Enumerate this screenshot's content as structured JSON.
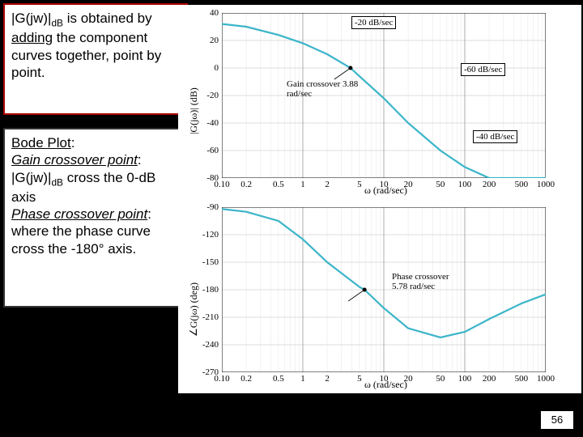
{
  "textbox1": {
    "full": "|G(jw)|dB is obtained by adding the component curves together, point by point.",
    "p1_a": "|G(jw)|",
    "p1_sub": "dB",
    "p1_b": " is obtained by ",
    "p1_add": "adding",
    "p1_c": " the component curves together, point by point."
  },
  "textbox2": {
    "heading": "Bode Plot",
    "gc1": "Gain crossover point",
    "gc2a": ": |G(jw)|",
    "gc2sub": "dB",
    "gc2b": " cross the 0-dB axis",
    "pc1": "Phase crossover point",
    "pc2": ": where the phase curve cross the -180° axis."
  },
  "figure": {
    "top": {
      "ylabel": "|G(jω)| (dB)",
      "xlabel": "ω (rad/sec)",
      "yticks": [
        "40",
        "20",
        "0",
        "-20",
        "-40",
        "-60",
        "-80"
      ],
      "xticks": [
        "0.10",
        "0.2",
        "0.5",
        "1",
        "2",
        "5",
        "10",
        "20",
        "50",
        "100",
        "200",
        "500",
        "1000"
      ],
      "annotations": {
        "a20": "-20 dB/sec",
        "a60": "-60 dB/sec",
        "a40": "-40 dB/sec",
        "gc": "Gain crossover 3.88 rad/sec"
      }
    },
    "bot": {
      "ylabel": "∠G(jω) (deg)",
      "xlabel": "ω (rad/sec)",
      "yticks": [
        "-90",
        "-120",
        "-150",
        "-180",
        "-210",
        "-240",
        "-270"
      ],
      "xticks": [
        "0.10",
        "0.2",
        "0.5",
        "1",
        "2",
        "5",
        "10",
        "20",
        "50",
        "100",
        "200",
        "500",
        "1000"
      ],
      "annotations": {
        "pc": "Phase crossover 5.78 rad/sec"
      }
    }
  },
  "page_number": "56",
  "chart_data": [
    {
      "type": "line",
      "title": "Magnitude",
      "xlabel": "ω (rad/sec)",
      "ylabel": "|G(jω)| (dB)",
      "x_scale": "log",
      "xlim": [
        0.1,
        1000
      ],
      "ylim": [
        -80,
        40
      ],
      "series": [
        {
          "name": "|G(jω)|",
          "x": [
            0.1,
            0.2,
            0.5,
            1,
            2,
            3.88,
            5,
            10,
            20,
            50,
            100,
            200,
            500,
            1000
          ],
          "values": [
            32,
            30,
            24,
            18,
            10,
            0,
            -6,
            -22,
            -40,
            -60,
            -72,
            -80,
            -80,
            -80
          ]
        }
      ],
      "annotations": [
        {
          "text": "-20 dB/sec",
          "x": 5,
          "y": 30
        },
        {
          "text": "-60 dB/sec",
          "x": 60,
          "y": -10
        },
        {
          "text": "-40 dB/sec",
          "x": 300,
          "y": -52
        },
        {
          "text": "Gain crossover 3.88 rad/sec",
          "x": 3.88,
          "y": 0,
          "point": true
        }
      ]
    },
    {
      "type": "line",
      "title": "Phase",
      "xlabel": "ω (rad/sec)",
      "ylabel": "∠G(jω) (deg)",
      "x_scale": "log",
      "xlim": [
        0.1,
        1000
      ],
      "ylim": [
        -270,
        -90
      ],
      "series": [
        {
          "name": "∠G(jω)",
          "x": [
            0.1,
            0.2,
            0.5,
            1,
            2,
            5,
            5.78,
            10,
            20,
            50,
            100,
            200,
            500,
            1000
          ],
          "values": [
            -92,
            -95,
            -105,
            -125,
            -150,
            -177,
            -180,
            -200,
            -222,
            -232,
            -226,
            -212,
            -195,
            -185
          ]
        }
      ],
      "annotations": [
        {
          "text": "Phase crossover 5.78 rad/sec",
          "x": 5.78,
          "y": -180,
          "point": true
        }
      ]
    }
  ]
}
